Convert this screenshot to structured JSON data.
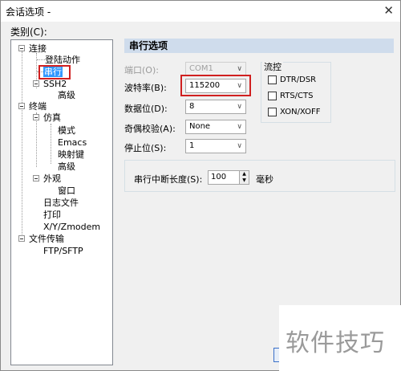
{
  "window": {
    "title": "会话选项 - "
  },
  "category_label": "类别(C):",
  "tree": [
    {
      "label": "连接"
    },
    {
      "label": "登陆动作"
    },
    {
      "label": "串行"
    },
    {
      "label": "SSH2"
    },
    {
      "label": "高级"
    },
    {
      "label": "终端"
    },
    {
      "label": "仿真"
    },
    {
      "label": "模式"
    },
    {
      "label": "Emacs"
    },
    {
      "label": "映射键"
    },
    {
      "label": "高级"
    },
    {
      "label": "外观"
    },
    {
      "label": "窗口"
    },
    {
      "label": "日志文件"
    },
    {
      "label": "打印"
    },
    {
      "label": "X/Y/Zmodem"
    },
    {
      "label": "文件传输"
    },
    {
      "label": "FTP/SFTP"
    }
  ],
  "section_title": "串行选项",
  "fields": {
    "port": {
      "label": "端口(O):",
      "value": "COM1"
    },
    "baud": {
      "label": "波特率(B):",
      "value": "115200"
    },
    "databits": {
      "label": "数据位(D):",
      "value": "8"
    },
    "parity": {
      "label": "奇偶校验(A):",
      "value": "None"
    },
    "stopbits": {
      "label": "停止位(S):",
      "value": "1"
    }
  },
  "flow": {
    "title": "流控",
    "items": [
      {
        "label": "DTR/DSR",
        "checked": false
      },
      {
        "label": "RTS/CTS",
        "checked": false
      },
      {
        "label": "XON/XOFF",
        "checked": false
      }
    ]
  },
  "break_length": {
    "label": "串行中断长度(S):",
    "value": "100",
    "unit": "毫秒"
  },
  "watermark": "软件技巧"
}
